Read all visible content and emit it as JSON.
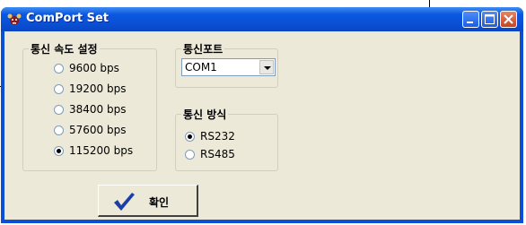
{
  "window": {
    "title": "ComPort Set"
  },
  "title_buttons": [
    "minimize",
    "maximize",
    "close"
  ],
  "baud_group": {
    "legend": "통신 속도 설정",
    "options": [
      {
        "label": "9600 bps",
        "checked": false
      },
      {
        "label": "19200 bps",
        "checked": false
      },
      {
        "label": "38400 bps",
        "checked": false
      },
      {
        "label": "57600 bps",
        "checked": false
      },
      {
        "label": "115200 bps",
        "checked": true
      }
    ]
  },
  "port_group": {
    "legend": "통신포트",
    "selected": "COM1"
  },
  "mode_group": {
    "legend": "통신 방식",
    "options": [
      {
        "label": "RS232",
        "checked": true
      },
      {
        "label": "RS485",
        "checked": false
      }
    ]
  },
  "ok_button": {
    "label": "확인"
  },
  "colors": {
    "titlebar": "#0a4fd4",
    "client": "#ece9d8",
    "close_button": "#c8431f"
  }
}
